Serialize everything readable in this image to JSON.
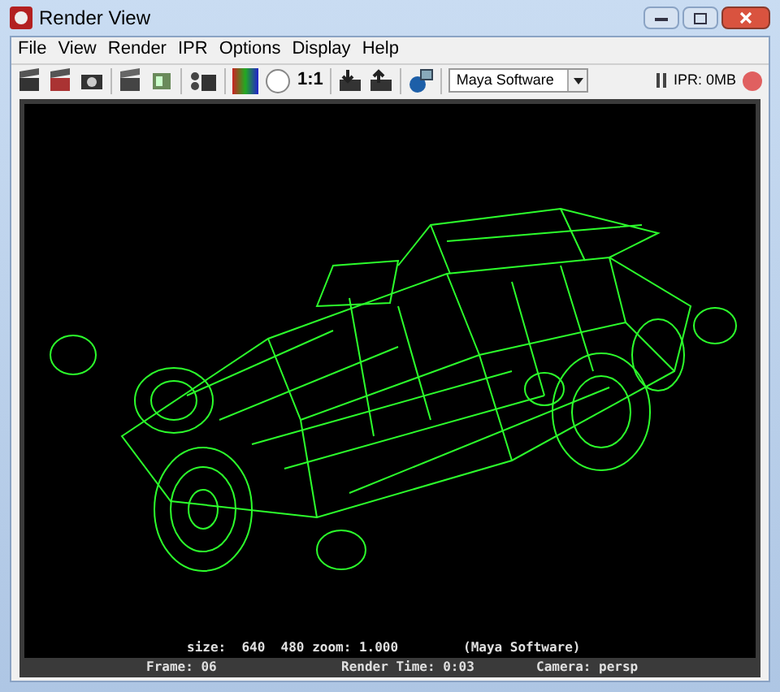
{
  "window": {
    "title": "Render View"
  },
  "menu": [
    "File",
    "View",
    "Render",
    "IPR",
    "Options",
    "Display",
    "Help"
  ],
  "toolbar": {
    "ratio_label": "1:1",
    "renderer": "Maya Software",
    "ipr_memory": "IPR: 0MB"
  },
  "render_info": {
    "size": "size:  640  480 zoom: 1.000",
    "renderer": "(Maya Software)",
    "frame": "Frame: 06",
    "render_time": "Render Time: 0:03",
    "camera": "Camera: persp"
  }
}
